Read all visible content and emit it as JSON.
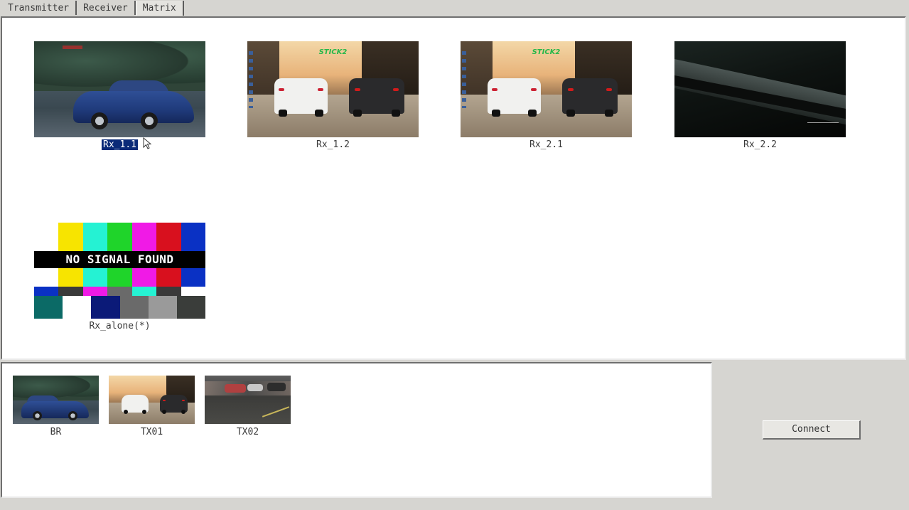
{
  "tabs": [
    {
      "label": "Transmitter"
    },
    {
      "label": "Receiver"
    },
    {
      "label": "Matrix",
      "active": true
    }
  ],
  "receivers": [
    {
      "label": "Rx_1.1",
      "selected": true,
      "preview": "blue-car"
    },
    {
      "label": "Rx_1.2",
      "selected": false,
      "preview": "street-race"
    },
    {
      "label": "Rx_2.1",
      "selected": false,
      "preview": "street-race"
    },
    {
      "label": "Rx_2.2",
      "selected": false,
      "preview": "dark-video"
    },
    {
      "label": "Rx_alone(*)",
      "selected": false,
      "preview": "no-signal"
    }
  ],
  "preview_text": {
    "stick": "STICK2",
    "no_signal": "NO SIGNAL FOUND"
  },
  "transmitters": [
    {
      "label": "BR",
      "preview": "blue-car"
    },
    {
      "label": "TX01",
      "preview": "street-race"
    },
    {
      "label": "TX02",
      "preview": "racing-cars"
    }
  ],
  "actions": {
    "connect_label": "Connect"
  },
  "colors": {
    "window_bg": "#d6d5d1",
    "panel_bg": "#ffffff",
    "selection_bg": "#0a2a78",
    "test_pattern": [
      "#f7e400",
      "#25f2d3",
      "#1fd42a",
      "#f01ae6",
      "#d8101e",
      "#0a31c4"
    ]
  }
}
